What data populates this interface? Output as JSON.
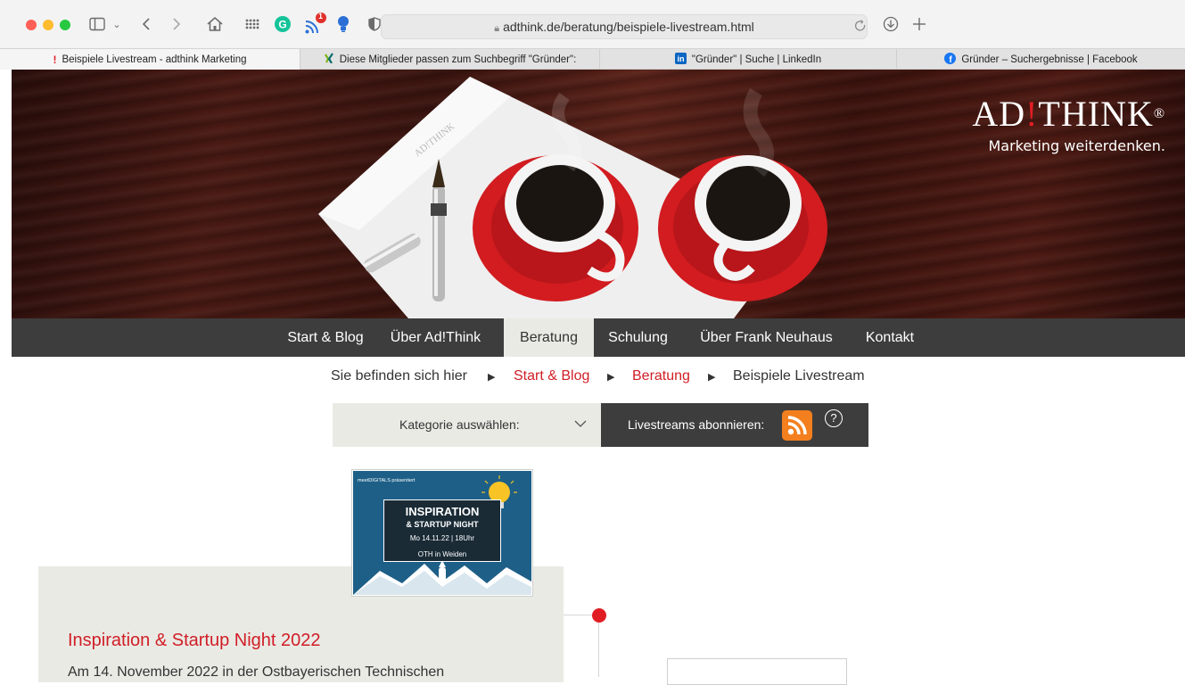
{
  "browser": {
    "url": "adthink.de/beratung/beispiele-livestream.html",
    "notification_count": "1",
    "tabs": [
      {
        "title": "Beispiele Livestream - adthink Marketing",
        "favicon": "!"
      },
      {
        "title": "Diese Mitglieder passen zum Suchbegriff \"Gründer\":",
        "favicon": "xing-icon"
      },
      {
        "title": "\"Gründer\" | Suche | LinkedIn",
        "favicon": "linkedin-icon"
      },
      {
        "title": "Gründer – Suchergebnisse | Facebook",
        "favicon": "facebook-icon"
      }
    ]
  },
  "logo": {
    "wordmark_pre": "AD",
    "wordmark_mark": "!",
    "wordmark_post": "THINK",
    "registered": "®",
    "tagline": "Marketing weiterdenken."
  },
  "nav": {
    "items": [
      "Start & Blog",
      "Über Ad!Think",
      "Beratung",
      "Schulung",
      "Über Frank Neuhaus",
      "Kontakt"
    ],
    "active": "Beratung"
  },
  "breadcrumb": {
    "prefix": "Sie befinden sich hier",
    "items": [
      "Start & Blog",
      "Beratung",
      "Beispiele Livestream"
    ],
    "separator": "▶"
  },
  "filter": {
    "category_label": "Kategorie auswählen:",
    "subscribe_label": "Livestreams abonnieren:",
    "help": "?"
  },
  "post": {
    "title": "Inspiration & Startup Night 2022",
    "excerpt": "Am 14. November 2022 in der Ostbayerischen Technischen",
    "thumbnail": {
      "presenter": "meetDIGITALS präsentiert",
      "line1": "INSPIRATION",
      "line2": "& STARTUP NIGHT",
      "line3": "Mo 14.11.22 | 18Uhr",
      "line4": "OTH in Weiden"
    }
  },
  "colors": {
    "accent_red": "#d01e26",
    "nav_bg": "#3d3d3d",
    "panel_bg": "#eaeae5",
    "rss_orange": "#f47f1e"
  }
}
